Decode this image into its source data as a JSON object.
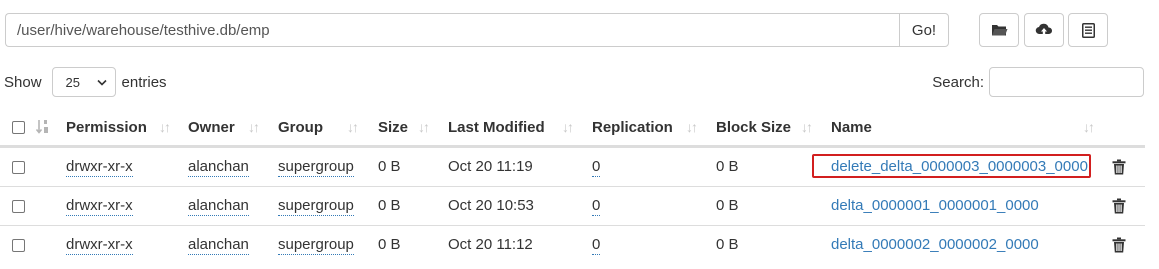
{
  "path_bar": {
    "value": "/user/hive/warehouse/testhive.db/emp",
    "go_label": "Go!"
  },
  "toolbar": {
    "icons": [
      "folder-icon",
      "upload-icon",
      "list-icon"
    ]
  },
  "length_control": {
    "prefix": "Show",
    "selected": "25",
    "suffix": "entries"
  },
  "search": {
    "label": "Search:",
    "value": ""
  },
  "table": {
    "columns": [
      "Permission",
      "Owner",
      "Group",
      "Size",
      "Last Modified",
      "Replication",
      "Block Size",
      "Name"
    ],
    "rows": [
      {
        "permission": "drwxr-xr-x",
        "owner": "alanchan",
        "group": "supergroup",
        "size": "0 B",
        "modified": "Oct 20 11:19",
        "replication": "0",
        "block_size": "0 B",
        "name": "delete_delta_0000003_0000003_0000"
      },
      {
        "permission": "drwxr-xr-x",
        "owner": "alanchan",
        "group": "supergroup",
        "size": "0 B",
        "modified": "Oct 20 10:53",
        "replication": "0",
        "block_size": "0 B",
        "name": "delta_0000001_0000001_0000"
      },
      {
        "permission": "drwxr-xr-x",
        "owner": "alanchan",
        "group": "supergroup",
        "size": "0 B",
        "modified": "Oct 20 11:12",
        "replication": "0",
        "block_size": "0 B",
        "name": "delta_0000002_0000002_0000"
      }
    ]
  },
  "colors": {
    "link": "#337ab7",
    "highlight_border": "#d21f1f",
    "border": "#dddddd"
  }
}
